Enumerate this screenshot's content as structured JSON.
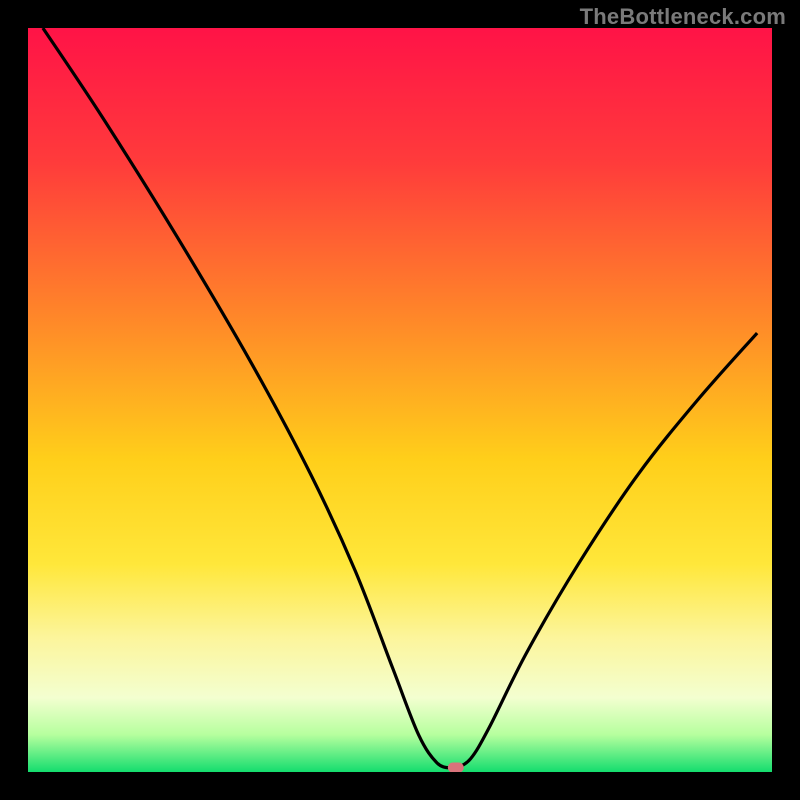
{
  "watermark": "TheBottleneck.com",
  "colors": {
    "bg": "#000000",
    "curve": "#000000",
    "marker": "#d9737b"
  },
  "chart_data": {
    "type": "line",
    "title": "",
    "xlabel": "",
    "ylabel": "",
    "xlim": [
      0,
      100
    ],
    "ylim": [
      0,
      100
    ],
    "grid": false,
    "legend": false,
    "gradient_stops": [
      {
        "offset": 0,
        "color": "#ff1347"
      },
      {
        "offset": 18,
        "color": "#ff3b3b"
      },
      {
        "offset": 40,
        "color": "#ff8b28"
      },
      {
        "offset": 58,
        "color": "#ffcf1a"
      },
      {
        "offset": 72,
        "color": "#ffe73a"
      },
      {
        "offset": 82,
        "color": "#fcf59c"
      },
      {
        "offset": 90,
        "color": "#f3ffd0"
      },
      {
        "offset": 95,
        "color": "#b6ff9e"
      },
      {
        "offset": 100,
        "color": "#14dd6e"
      }
    ],
    "series": [
      {
        "name": "bottleneck-curve",
        "x": [
          2,
          10,
          20,
          30,
          38,
          44,
          49,
          52.5,
          55,
          57,
          57.5,
          59.5,
          62,
          67,
          74,
          82,
          90,
          98
        ],
        "y": [
          100,
          88,
          72,
          55,
          40,
          27,
          14,
          5,
          1.2,
          0.5,
          0.5,
          1.8,
          6,
          16,
          28,
          40,
          50,
          59
        ]
      }
    ],
    "marker": {
      "x": 57.5,
      "y": 0.6
    }
  }
}
